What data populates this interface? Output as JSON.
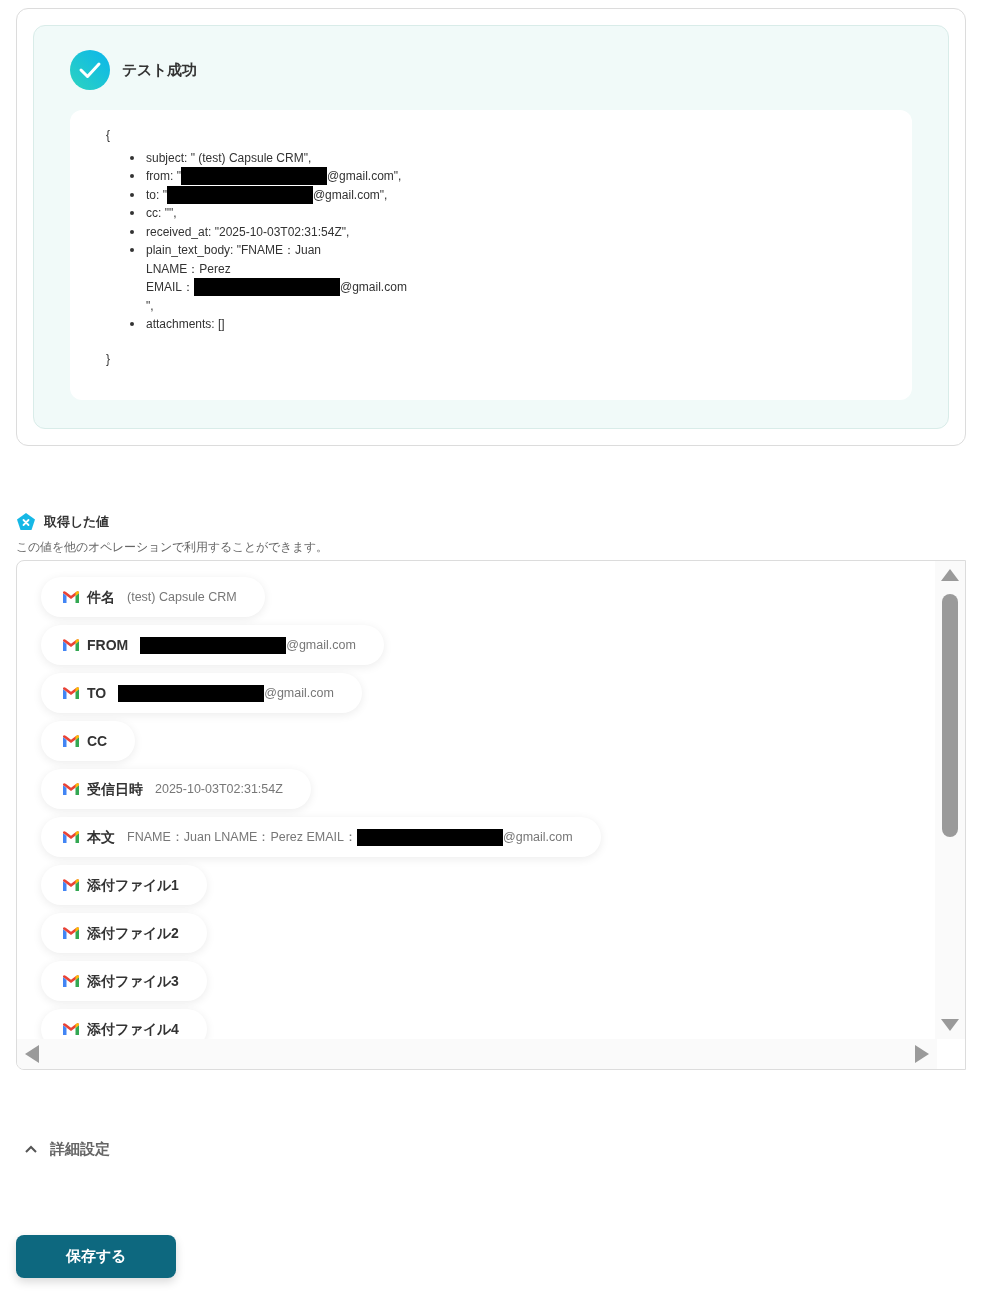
{
  "test_result": {
    "title": "テスト成功",
    "open_brace": "{",
    "close_brace": "}",
    "items": [
      {
        "lines": [
          {
            "before": "subject: \" (test) Capsule CRM\",",
            "redacted": false
          }
        ]
      },
      {
        "lines": [
          {
            "before": "from: \"",
            "redacted": true,
            "after": "@gmail.com\","
          }
        ]
      },
      {
        "lines": [
          {
            "before": "to: \"",
            "redacted": true,
            "after": "@gmail.com\","
          }
        ]
      },
      {
        "lines": [
          {
            "before": "cc: \"\",",
            "redacted": false
          }
        ]
      },
      {
        "lines": [
          {
            "before": "received_at: \"2025-10-03T02:31:54Z\",",
            "redacted": false
          }
        ]
      },
      {
        "lines": [
          {
            "before": "plain_text_body: \"FNAME：Juan",
            "redacted": false
          },
          {
            "before": "LNAME：Perez",
            "redacted": false
          },
          {
            "before": "EMAIL：",
            "redacted": true,
            "after": "@gmail.com"
          },
          {
            "before": "\",",
            "redacted": false
          }
        ]
      },
      {
        "lines": [
          {
            "before": "attachments: []",
            "redacted": false
          }
        ]
      }
    ]
  },
  "values_section": {
    "title": "取得した値",
    "description": "この値を他のオペレーションで利用することができます。",
    "chips": [
      {
        "label": "件名",
        "value": "(test) Capsule CRM",
        "redacted": false
      },
      {
        "label": "FROM",
        "redacted": true,
        "value": "@gmail.com"
      },
      {
        "label": "TO",
        "redacted": true,
        "value": "@gmail.com"
      },
      {
        "label": "CC",
        "redacted": false
      },
      {
        "label": "受信日時",
        "value": "2025-10-03T02:31:54Z",
        "redacted": false
      },
      {
        "label": "本文",
        "prefix": "FNAME：Juan LNAME：Perez EMAIL：",
        "redacted": true,
        "value": "@gmail.com"
      },
      {
        "label": "添付ファイル1",
        "redacted": false
      },
      {
        "label": "添付ファイル2",
        "redacted": false
      },
      {
        "label": "添付ファイル3",
        "redacted": false
      },
      {
        "label": "添付ファイル4",
        "redacted": false
      }
    ]
  },
  "advanced_settings": {
    "label": "詳細設定",
    "expanded": true
  },
  "save_button": "保存する"
}
